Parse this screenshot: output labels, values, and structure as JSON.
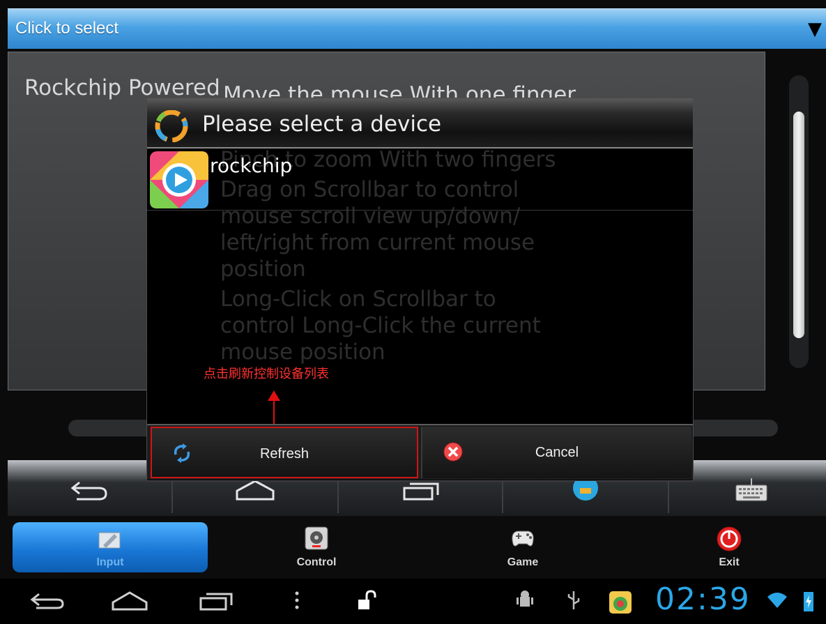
{
  "topbar": {
    "label": "Click to select"
  },
  "panel": {
    "brand": "Rockchip Powered",
    "help_lines": [
      "Move the mouse With one finger",
      "Pinch to zoom With two fingers",
      "Drag on Scrollbar to control",
      "mouse scroll view up/down/",
      "left/right from current mouse",
      "position",
      "Long-Click on Scrollbar to",
      "control Long-Click the current",
      "mouse position"
    ]
  },
  "dialog": {
    "title": "Please select a device",
    "device": "rockchip",
    "annotation": "点击刷新控制设备列表",
    "refresh_label": "Refresh",
    "cancel_label": "Cancel"
  },
  "tabs": [
    {
      "label": "Input",
      "icon": "input-icon",
      "active": true
    },
    {
      "label": "Control",
      "icon": "control-icon",
      "active": false
    },
    {
      "label": "Game",
      "icon": "gamepad-icon",
      "active": false
    },
    {
      "label": "Exit",
      "icon": "power-icon",
      "active": false
    }
  ],
  "system": {
    "clock": "02:39"
  },
  "colors": {
    "accent": "#2ba7e8",
    "annotation": "#ff3030",
    "exit": "#e02020"
  }
}
